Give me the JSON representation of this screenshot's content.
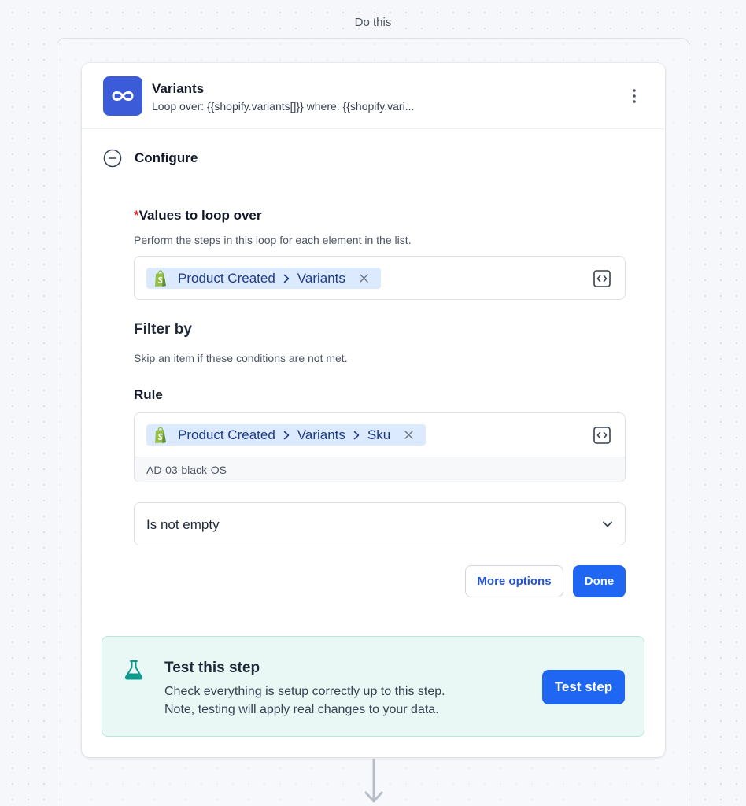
{
  "canvas": {
    "label": "Do this"
  },
  "step": {
    "icon": "loop-icon",
    "title": "Variants",
    "subtitle": "Loop over: {{shopify.variants[]}} where: {{shopify.vari..."
  },
  "configure": {
    "label": "Configure"
  },
  "loop_values": {
    "required_marker": "*",
    "label": "Values to loop over",
    "help": "Perform the steps in this loop for each element in the list.",
    "chip": {
      "app_icon": "shopify-icon",
      "path": [
        "Product Created",
        "Variants"
      ]
    }
  },
  "filter": {
    "title": "Filter by",
    "help": "Skip an item if these conditions are not met.",
    "rule_label": "Rule",
    "rule_chip": {
      "app_icon": "shopify-icon",
      "path": [
        "Product Created",
        "Variants",
        "Sku"
      ]
    },
    "rule_preview": "AD-03-black-OS",
    "condition": {
      "selected": "Is not empty"
    }
  },
  "actions": {
    "more_options": "More options",
    "done": "Done"
  },
  "test": {
    "icon": "flask-icon",
    "title": "Test this step",
    "line1": "Check everything is setup correctly up to this step.",
    "line2": "Note, testing will apply real changes to your data.",
    "button": "Test step"
  },
  "colors": {
    "primary": "#1f66f2",
    "app_icon_bg": "#3c5bd9",
    "chip_bg": "#dbeafe",
    "chip_text": "#1e3a8a",
    "required": "#dc2626",
    "test_panel_bg": "#e9f8f5"
  }
}
